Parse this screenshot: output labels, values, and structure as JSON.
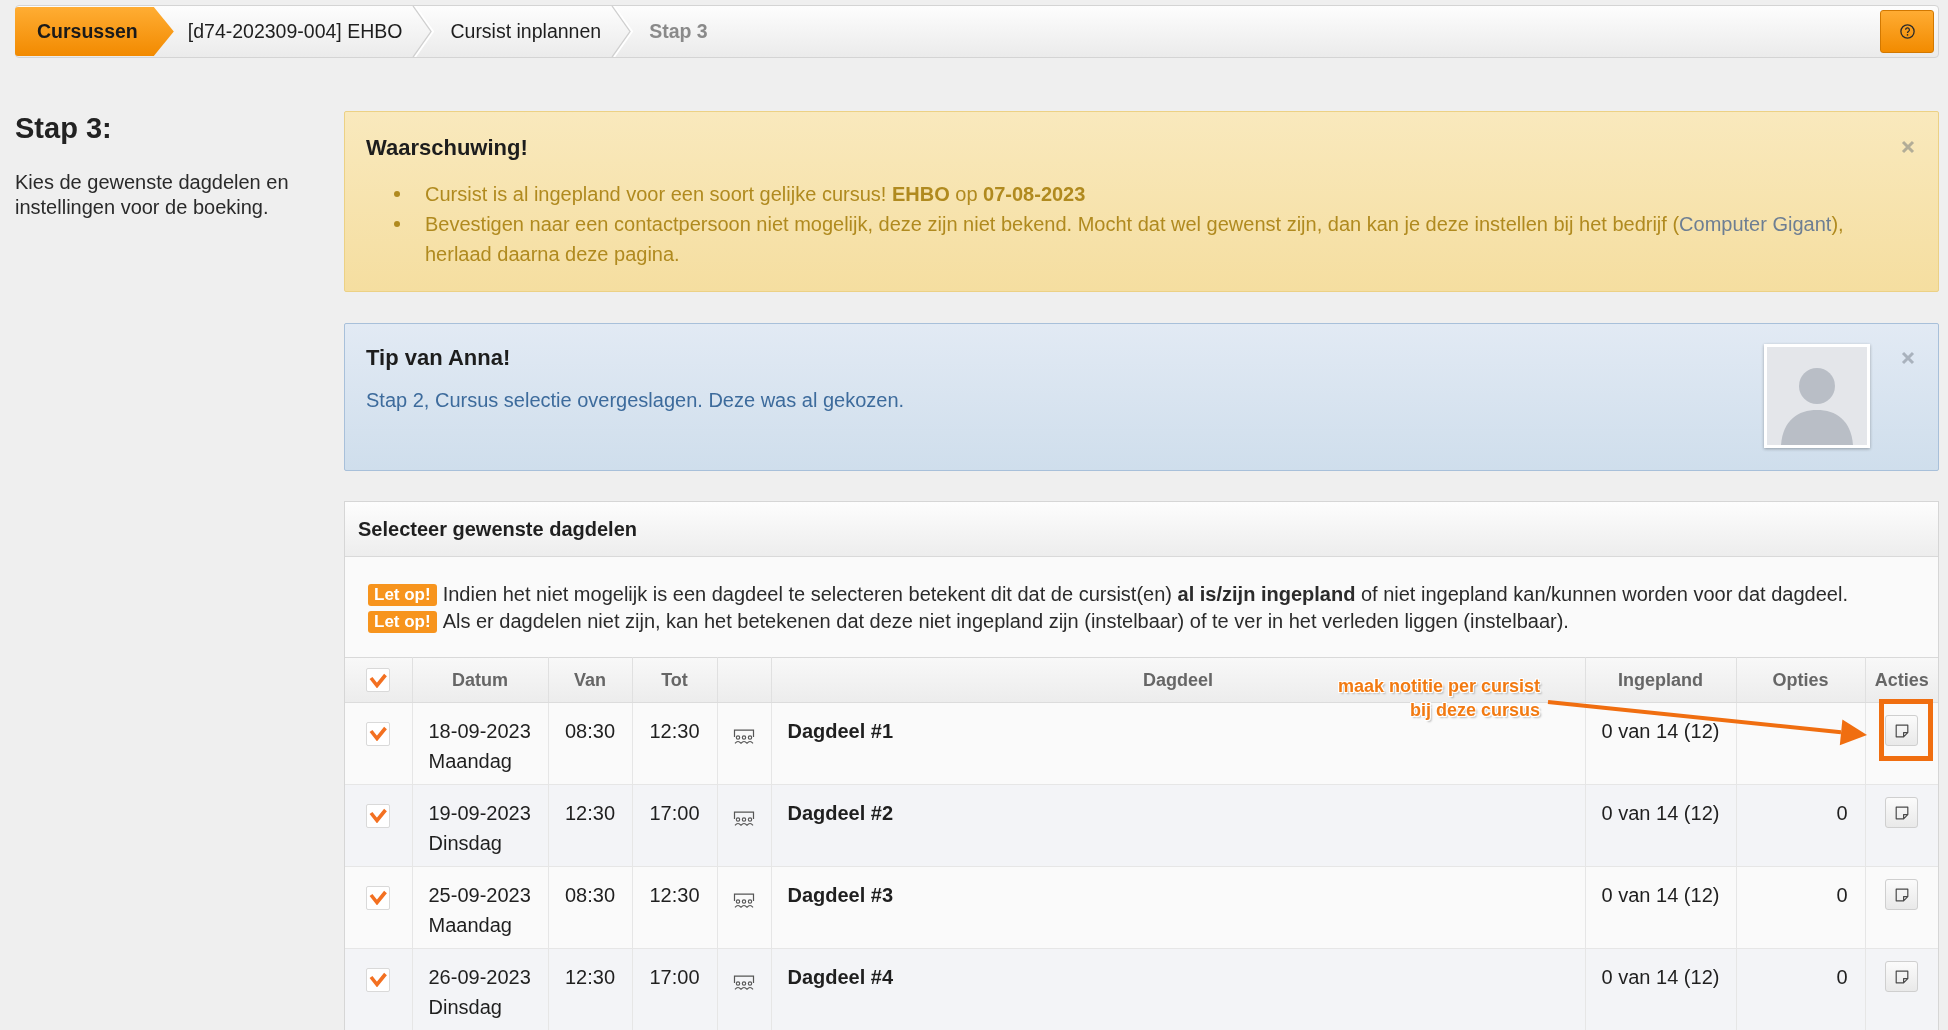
{
  "breadcrumb": [
    {
      "label": "Cursussen",
      "kind": "home"
    },
    {
      "label": "[d74-202309-004] EHBO",
      "kind": "link"
    },
    {
      "label": "Cursist inplannen",
      "kind": "link"
    },
    {
      "label": "Stap 3",
      "kind": "current"
    }
  ],
  "step": {
    "title": "Stap 3:",
    "description": "Kies de gewenste dagdelen en instellingen voor de boeking."
  },
  "warning": {
    "title": "Waarschuwing!",
    "items": [
      {
        "text": "Cursist is al ingepland voor een soort gelijke cursus! **EHBO** op **07-08-2023**"
      },
      {
        "text": "Bevestigen naar een contactpersoon niet mogelijk, deze zijn niet bekend. Mocht dat wel gewenst zijn, dan kan je deze instellen bij het bedrijf (",
        "link": "Computer Gigant",
        "text_after": "), herlaad daarna deze pagina."
      }
    ]
  },
  "tip": {
    "title": "Tip van Anna!",
    "text": "Stap 2, Cursus selectie overgeslagen. Deze was al gekozen."
  },
  "panel": {
    "title": "Selecteer gewenste dagdelen",
    "notes": [
      {
        "badge": "Let op!",
        "text": "Indien het niet mogelijk is een dagdeel te selecteren betekent dit dat de cursist(en) **al is/zijn ingepland** of niet ingepland kan/kunnen worden voor dat dagdeel."
      },
      {
        "badge": "Let op!",
        "text": "Als er dagdelen niet zijn, kan het betekenen dat deze niet ingepland zijn (instelbaar) of te ver in het verleden liggen (instelbaar)."
      }
    ]
  },
  "table": {
    "select_all_checked": true,
    "columns": [
      "Datum",
      "Van",
      "Tot",
      "Dagdeel",
      "Ingepland",
      "Opties",
      "Acties"
    ],
    "rows": [
      {
        "checked": true,
        "date": "18-09-2023",
        "weekday": "Maandag",
        "from": "08:30",
        "to": "12:30",
        "name": "Dagdeel #1",
        "planned": "0 van 14 (12)"
      },
      {
        "checked": true,
        "date": "19-09-2023",
        "weekday": "Dinsdag",
        "from": "12:30",
        "to": "17:00",
        "name": "Dagdeel #2",
        "planned": "0 van 14 (12)",
        "options": "0"
      },
      {
        "checked": true,
        "date": "25-09-2023",
        "weekday": "Maandag",
        "from": "08:30",
        "to": "12:30",
        "name": "Dagdeel #3",
        "planned": "0 van 14 (12)",
        "options": "0"
      },
      {
        "checked": true,
        "date": "26-09-2023",
        "weekday": "Dinsdag",
        "from": "12:30",
        "to": "17:00",
        "name": "Dagdeel #4",
        "planned": "0 van 14 (12)",
        "options": "0"
      }
    ]
  },
  "annotation": {
    "lines": [
      "maak notitie per cursist",
      "bij deze cursus"
    ]
  }
}
